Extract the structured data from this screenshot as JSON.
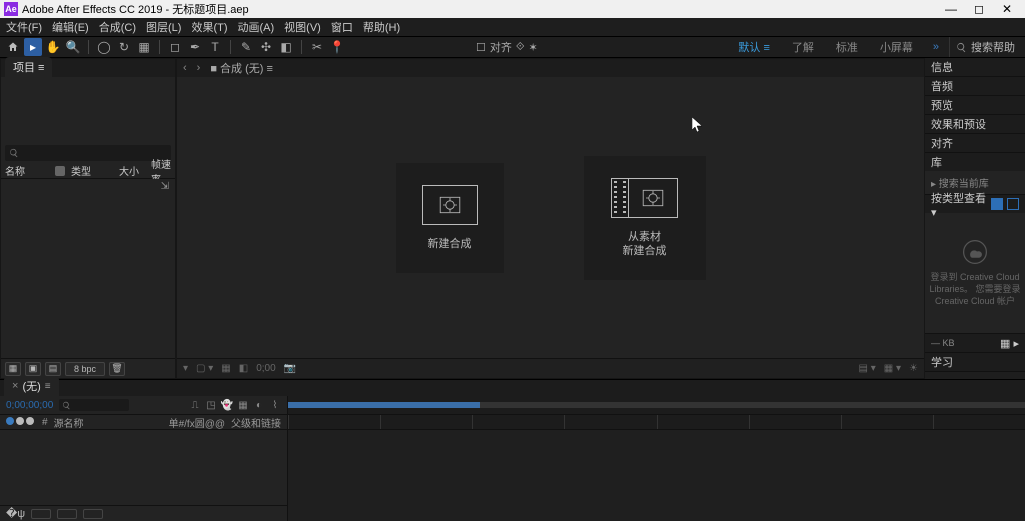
{
  "app": {
    "title": "Adobe After Effects CC 2019 - 无标题项目.aep",
    "icon_text": "Ae"
  },
  "menu": [
    "文件(F)",
    "编辑(E)",
    "合成(C)",
    "图层(L)",
    "效果(T)",
    "动画(A)",
    "视图(V)",
    "窗口",
    "帮助(H)"
  ],
  "toolbar": {
    "snapping_label": "对齐",
    "workspaces": [
      "默认 ≡",
      "了解",
      "标准",
      "小屏幕"
    ],
    "chevrons": "»",
    "search_label": "搜索帮助"
  },
  "project": {
    "tab": "项目 ≡",
    "headers": {
      "name": "名称",
      "type": "类型",
      "size": "大小",
      "fps": "帧速率"
    },
    "footer_bpc": "8 bpc"
  },
  "comp": {
    "tab_prefix": "■ 合成",
    "tab_name": "(无)",
    "menu_glyph": "≡",
    "card_new": "新建合成",
    "card_from_footage_l1": "从素材",
    "card_from_footage_l2": "新建合成"
  },
  "right": {
    "info": "信息",
    "audio": "音频",
    "preview": "预览",
    "effects": "效果和预设",
    "align": "对齐",
    "libraries_tab": "库",
    "libraries_search": "▸ 搜索当前库",
    "libraries_browse": "按类型查看 ▾",
    "libraries_msg": "登录到 Creative Cloud Libraries。 您需要登录 Creative Cloud 帐户",
    "kb_label": "— KB",
    "kb_glyph": "▦ ▸",
    "learn": "学习"
  },
  "timeline": {
    "tab": "(无)",
    "timecode": "0;00;00;00",
    "headers": {
      "num": "#",
      "src": "源名称",
      "switches": "单#/fx圆@@",
      "parent": "父级和链接"
    }
  }
}
